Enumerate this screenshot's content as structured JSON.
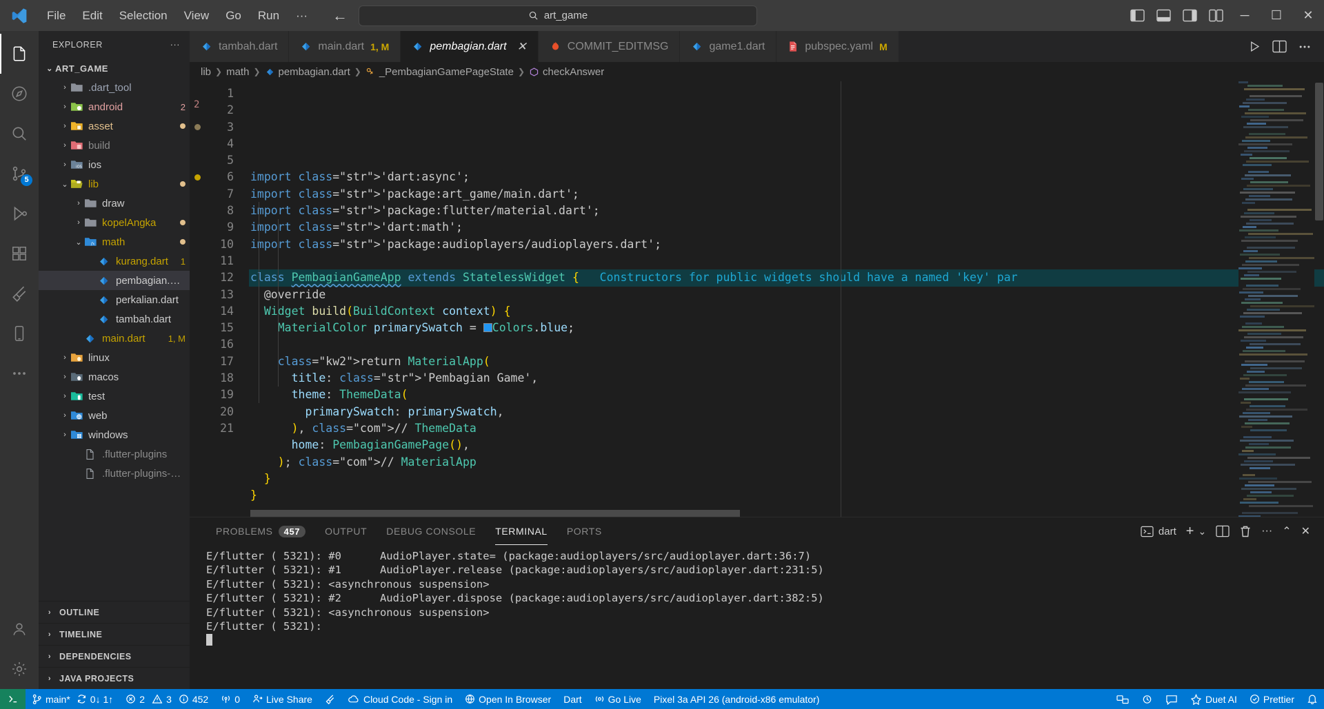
{
  "titlebar": {
    "logo": "vscode-logo",
    "menus": [
      "File",
      "Edit",
      "Selection",
      "View",
      "Go",
      "Run",
      "···"
    ],
    "back": "←",
    "forward": "→",
    "command_center_text": "art_game",
    "search_icon": "search-icon",
    "layout_icons": [
      "panel-left-icon",
      "panel-bottom-icon",
      "panel-right-icon",
      "layout-grid-icon"
    ],
    "minimize": "─",
    "maximize": "☐",
    "close": "✕"
  },
  "activitybar": {
    "items": [
      {
        "name": "explorer",
        "icon": "files-icon",
        "badge": ""
      },
      {
        "name": "accounts-preview",
        "icon": "compass-icon",
        "badge": ""
      },
      {
        "name": "search",
        "icon": "search-icon",
        "badge": ""
      },
      {
        "name": "source-control",
        "icon": "source-control-icon",
        "badge": "5"
      },
      {
        "name": "run-and-debug",
        "icon": "debug-icon",
        "badge": ""
      },
      {
        "name": "extensions",
        "icon": "extensions-icon",
        "badge": ""
      },
      {
        "name": "flutter",
        "icon": "flutter-icon",
        "badge": ""
      },
      {
        "name": "devices",
        "icon": "mobile-icon",
        "badge": ""
      },
      {
        "name": "more-views",
        "icon": "ellipsis-icon",
        "badge": ""
      }
    ],
    "bottom": [
      {
        "name": "accounts",
        "icon": "account-icon"
      },
      {
        "name": "manage",
        "icon": "gear-icon"
      }
    ]
  },
  "sidebar": {
    "title": "EXPLORER",
    "more_actions": "···",
    "root": {
      "label": "ART_GAME",
      "expanded": true
    },
    "tree": [
      {
        "label": ".dart_tool",
        "indent": 1,
        "twisty": "›",
        "icon": "folder",
        "color": "#9da5b4",
        "fcolor": "#8c9099",
        "badge": "",
        "dot": ""
      },
      {
        "label": "android",
        "indent": 1,
        "twisty": "›",
        "icon": "folder-android",
        "color": "#e2a0a0",
        "fcolor": "#8bc34a",
        "badge": "2",
        "badgecolor": "#e2a0a0",
        "dot": ""
      },
      {
        "label": "asset",
        "indent": 1,
        "twisty": "›",
        "icon": "folder-asset",
        "color": "#e2c08d",
        "fcolor": "#f0b429",
        "badge": "",
        "dot": "#e2c08d"
      },
      {
        "label": "build",
        "indent": 1,
        "twisty": "›",
        "icon": "folder-build",
        "color": "#8c8c8c",
        "fcolor": "#e06c75",
        "badge": "",
        "dot": ""
      },
      {
        "label": "ios",
        "indent": 1,
        "twisty": "›",
        "icon": "folder-ios",
        "color": "#cccccc",
        "fcolor": "#6b8299",
        "badge": "",
        "dot": ""
      },
      {
        "label": "lib",
        "indent": 1,
        "twisty": "⌄",
        "icon": "folder-open-lib",
        "color": "#c5a300",
        "fcolor": "#c8c420",
        "badge": "",
        "dot": "#e2c08d"
      },
      {
        "label": "draw",
        "indent": 2,
        "twisty": "›",
        "icon": "folder",
        "color": "#cccccc",
        "fcolor": "#8c9099",
        "badge": "",
        "dot": ""
      },
      {
        "label": "kopelAngka",
        "indent": 2,
        "twisty": "›",
        "icon": "folder",
        "color": "#c5a300",
        "fcolor": "#8c9099",
        "badge": "",
        "dot": "#e2c08d"
      },
      {
        "label": "math",
        "indent": 2,
        "twisty": "⌄",
        "icon": "folder-fx",
        "color": "#c5a300",
        "fcolor": "#2f8ad8",
        "badge": "",
        "dot": "#e2c08d"
      },
      {
        "label": "kurang.dart",
        "indent": 3,
        "twisty": "",
        "icon": "dart",
        "color": "#c5a300",
        "badge": "1",
        "badgecolor": "#c5a300",
        "dot": ""
      },
      {
        "label": "pembagian.dart",
        "indent": 3,
        "twisty": "",
        "icon": "dart",
        "color": "#cccccc",
        "badge": "",
        "dot": "",
        "selected": true
      },
      {
        "label": "perkalian.dart",
        "indent": 3,
        "twisty": "",
        "icon": "dart",
        "color": "#cccccc",
        "badge": "",
        "dot": ""
      },
      {
        "label": "tambah.dart",
        "indent": 3,
        "twisty": "",
        "icon": "dart",
        "color": "#cccccc",
        "badge": "",
        "dot": ""
      },
      {
        "label": "main.dart",
        "indent": 2,
        "twisty": "",
        "icon": "dart",
        "color": "#c5a300",
        "badge": "1, M",
        "badgecolor": "#c5a300",
        "dot": ""
      },
      {
        "label": "linux",
        "indent": 1,
        "twisty": "›",
        "icon": "folder-linux",
        "color": "#cccccc",
        "fcolor": "#e8a33d",
        "badge": "",
        "dot": ""
      },
      {
        "label": "macos",
        "indent": 1,
        "twisty": "›",
        "icon": "folder-macos",
        "color": "#cccccc",
        "fcolor": "#5a6b78",
        "badge": "",
        "dot": ""
      },
      {
        "label": "test",
        "indent": 1,
        "twisty": "›",
        "icon": "folder-test",
        "color": "#cccccc",
        "fcolor": "#1abc9c",
        "badge": "",
        "dot": ""
      },
      {
        "label": "web",
        "indent": 1,
        "twisty": "›",
        "icon": "folder-web",
        "color": "#cccccc",
        "fcolor": "#2f8ad8",
        "badge": "",
        "dot": ""
      },
      {
        "label": "windows",
        "indent": 1,
        "twisty": "›",
        "icon": "folder-windows",
        "color": "#cccccc",
        "fcolor": "#2f8ad8",
        "badge": "",
        "dot": ""
      },
      {
        "label": ".flutter-plugins",
        "indent": 2,
        "twisty": "",
        "icon": "file",
        "color": "#8c8c8c",
        "badge": "",
        "dot": ""
      },
      {
        "label": ".flutter-plugins-de...",
        "indent": 2,
        "twisty": "",
        "icon": "file",
        "color": "#8c8c8c",
        "badge": "",
        "dot": ""
      }
    ],
    "sections": [
      "OUTLINE",
      "TIMELINE",
      "DEPENDENCIES",
      "JAVA PROJECTS"
    ]
  },
  "tabs": [
    {
      "label": "tambah.dart",
      "icon": "dart-icon",
      "mod": "",
      "active": false,
      "closable": false
    },
    {
      "label": "main.dart",
      "icon": "dart-icon",
      "mod": "1, M",
      "active": false,
      "closable": false
    },
    {
      "label": "pembagian.dart",
      "icon": "dart-icon",
      "mod": "",
      "active": true,
      "closable": true
    },
    {
      "label": "COMMIT_EDITMSG",
      "icon": "git-icon",
      "mod": "",
      "active": false,
      "closable": false
    },
    {
      "label": "game1.dart",
      "icon": "dart-icon",
      "mod": "",
      "active": false,
      "closable": false
    },
    {
      "label": "pubspec.yaml",
      "icon": "yaml-icon",
      "mod": "M",
      "active": false,
      "closable": false
    }
  ],
  "editor_actions": [
    "run-icon",
    "split-editor-icon",
    "more-actions-icon"
  ],
  "breadcrumb": [
    {
      "label": "lib",
      "icon": ""
    },
    {
      "label": "math",
      "icon": ""
    },
    {
      "label": "pembagian.dart",
      "icon": "dart-icon"
    },
    {
      "label": "_PembagianGamePageState",
      "icon": "class-icon"
    },
    {
      "label": "checkAnswer",
      "icon": "method-icon"
    }
  ],
  "code": {
    "first_line": 1,
    "last_line": 21,
    "lines": [
      "import 'dart:async';",
      "import 'package:art_game/main.dart';",
      "import 'package:flutter/material.dart';",
      "import 'dart:math';",
      "import 'package:audioplayers/audioplayers.dart';",
      "",
      "class PembagianGameApp extends StatelessWidget {",
      "  @override",
      "  Widget build(BuildContext context) {",
      "    MaterialColor primarySwatch = Colors.blue;",
      "",
      "    return MaterialApp(",
      "      title: 'Pembagian Game',",
      "      theme: ThemeData(",
      "        primarySwatch: primarySwatch,",
      "      ), // ThemeData",
      "      home: PembagianGamePage(),",
      "    ); // MaterialApp",
      "  }",
      "}",
      ""
    ],
    "inline_hint_line7": "Constructors for public widgets should have a named 'key' par"
  },
  "panel": {
    "tabs": [
      {
        "label": "PROBLEMS",
        "count": "457",
        "active": false
      },
      {
        "label": "OUTPUT",
        "count": "",
        "active": false
      },
      {
        "label": "DEBUG CONSOLE",
        "count": "",
        "active": false
      },
      {
        "label": "TERMINAL",
        "count": "",
        "active": true
      },
      {
        "label": "PORTS",
        "count": "",
        "active": false
      }
    ],
    "actions": {
      "shell_label": "dart",
      "shell_icon": "terminal-icon",
      "new_terminal": "+",
      "new_terminal_dropdown": "⌄",
      "split": "split-icon",
      "kill": "trash-icon",
      "more": "···",
      "maximize": "⌃",
      "close": "✕"
    },
    "terminal_lines": [
      "E/flutter ( 5321): #0      AudioPlayer.state= (package:audioplayers/src/audioplayer.dart:36:7)",
      "E/flutter ( 5321): #1      AudioPlayer.release (package:audioplayers/src/audioplayer.dart:231:5)",
      "E/flutter ( 5321): <asynchronous suspension>",
      "E/flutter ( 5321): #2      AudioPlayer.dispose (package:audioplayers/src/audioplayer.dart:382:5)",
      "E/flutter ( 5321): <asynchronous suspension>",
      "E/flutter ( 5321):"
    ]
  },
  "statusbar": {
    "remote_icon": "remote-icon",
    "branch": "main*",
    "sync": "0↓ 1↑",
    "errors": "2",
    "warnings": "3",
    "infos": "452",
    "radio_tower": "0",
    "live_share": "Live Share",
    "flutter_bolt": "flutter-icon",
    "cloud_code": "Cloud Code - Sign in",
    "open_in_browser": "Open In Browser",
    "dart": "Dart",
    "go_live": "Go Live",
    "device": "Pixel 3a API 26 (android-x86 emulator)",
    "duet": "Duet AI",
    "prettier": "Prettier",
    "bell": "bell-icon"
  },
  "colors": {
    "accent": "#0078d4",
    "remote_green": "#16825d",
    "tab_active_bg": "#1e1e1e",
    "editor_bg": "#1e1e1e",
    "sidebar_bg": "#252526",
    "activitybar_bg": "#333333",
    "titlebar_bg": "#3c3c3c",
    "modified_yellow": "#cca700"
  }
}
